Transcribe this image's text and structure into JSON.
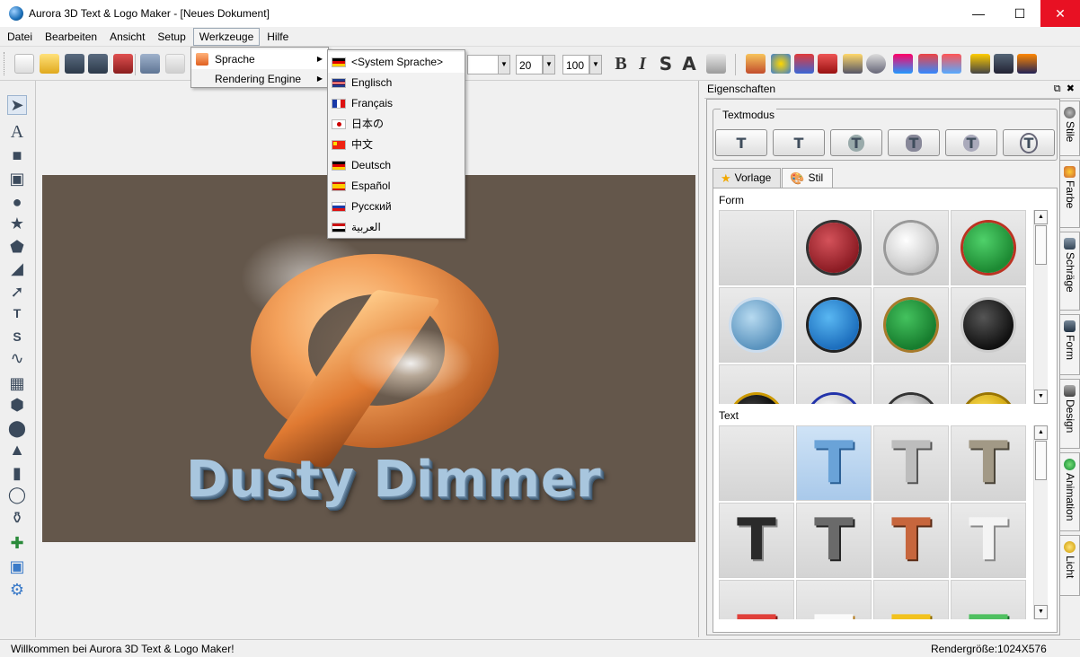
{
  "window": {
    "title": "Aurora 3D Text & Logo Maker - [Neues Dokument]"
  },
  "menubar": [
    "Datei",
    "Bearbeiten",
    "Ansicht",
    "Setup",
    "Werkzeuge",
    "Hilfe"
  ],
  "werkzeuge_menu": {
    "items": [
      "Sprache",
      "Rendering Engine"
    ]
  },
  "sprache_menu": {
    "items": [
      {
        "label": "<System Sprache>",
        "flag": "de"
      },
      {
        "label": "Englisch",
        "flag": "gb"
      },
      {
        "label": "Français",
        "flag": "fr"
      },
      {
        "label": "日本の",
        "flag": "jp"
      },
      {
        "label": "中文",
        "flag": "cn"
      },
      {
        "label": "Deutsch",
        "flag": "de"
      },
      {
        "label": "Español",
        "flag": "es"
      },
      {
        "label": "Русский",
        "flag": "ru"
      },
      {
        "label": "العربية",
        "flag": "eg"
      }
    ]
  },
  "toolbar": {
    "size_value": "20",
    "percent_value": "100",
    "format_buttons": [
      "B",
      "I",
      "S",
      "A"
    ]
  },
  "canvas": {
    "logo_text": "Dusty Dimmer",
    "background_color": "#64574b"
  },
  "properties": {
    "title": "Eigenschaften",
    "textmodus_label": "Textmodus",
    "tabs": [
      "Vorlage",
      "Stil"
    ],
    "form_label": "Form",
    "text_label": "Text"
  },
  "side_tabs": [
    "Stile",
    "Farbe",
    "Schräge",
    "Form",
    "Design",
    "Animation",
    "Licht"
  ],
  "status": {
    "left": "Willkommen bei Aurora 3D Text & Logo Maker!",
    "right": "Rendergröße:1024X576"
  }
}
